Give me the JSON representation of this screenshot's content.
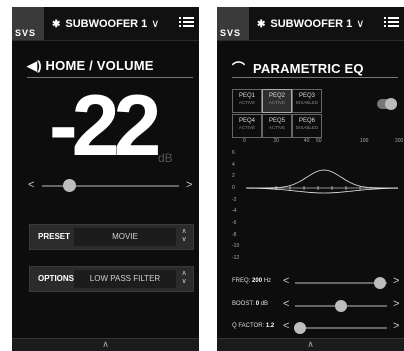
{
  "left": {
    "device_name": "SUBWOOFER 1",
    "logo_text": "SVS",
    "title": "HOME / VOLUME",
    "volume_value": "-22",
    "volume_unit": "dB",
    "volume_slider_level": 0.2,
    "preset_label": "PRESET",
    "preset_value": "MOVIE",
    "options_label": "OPTIONS",
    "options_value": "LOW PASS FILTER"
  },
  "right": {
    "device_name": "SUBWOOFER 1",
    "logo_text": "SVS",
    "title": "PARAMETRIC EQ",
    "peq_cells": [
      {
        "name": "PEQ1",
        "status": "ACTIVE"
      },
      {
        "name": "PEQ2",
        "status": "ACTIVE"
      },
      {
        "name": "PEQ3",
        "status": "DISABLED"
      },
      {
        "name": "PEQ4",
        "status": "ACTIVE"
      },
      {
        "name": "PEQ5",
        "status": "ACTIVE"
      },
      {
        "name": "PEQ6",
        "status": "DISABLED"
      }
    ],
    "x_ticks": [
      "0",
      "20",
      "40",
      "50",
      "100",
      "200"
    ],
    "y_ticks": [
      "6",
      "4",
      "2",
      "0",
      "-2",
      "-4",
      "-6",
      "-8",
      "-10",
      "-12"
    ],
    "freq_label": "FREQ:",
    "freq_value": "200",
    "freq_unit": "Hz",
    "boost_label": "BOOST:",
    "boost_value": "0",
    "boost_unit": "dB",
    "q_label": "Q FACTOR:",
    "q_value": "1.2",
    "freq_level": 0.92,
    "boost_level": 0.5,
    "q_level": 0.05
  },
  "colors": {
    "background": "#0d0d0d",
    "logo_bg": "#3a3a3a",
    "accent": "#ffffff"
  },
  "icons": [
    "bluetooth-icon",
    "chevron-down-icon",
    "menu-icon",
    "speaker-icon",
    "eq-curve-icon",
    "chevron-up-icon"
  ]
}
